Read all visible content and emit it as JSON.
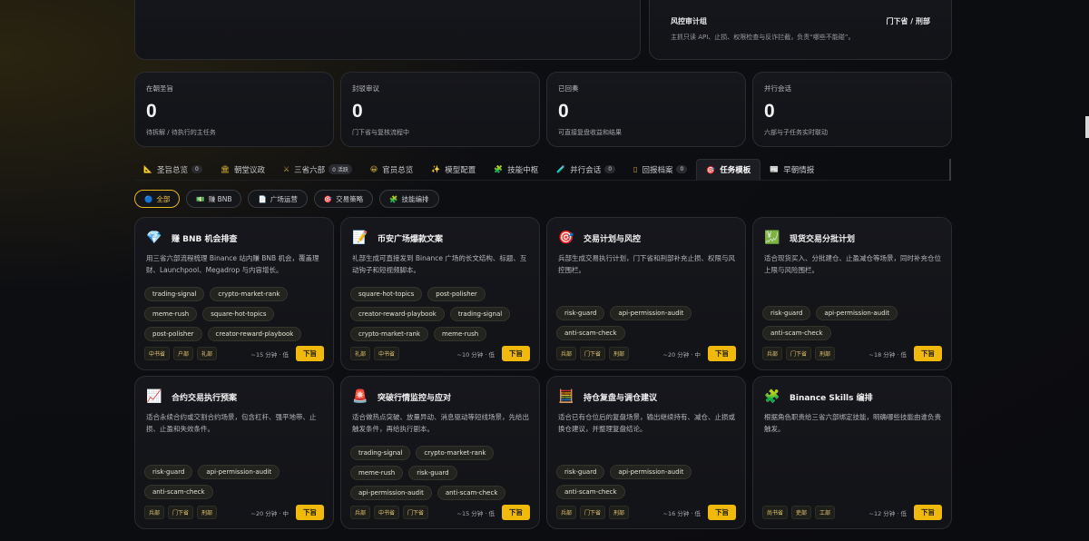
{
  "audit_group": {
    "title": "风控审计组",
    "depts": "门下省 / 刑部",
    "desc": "主抓只读 API、止损、权限检查与反诈拦截，负责“哪些不能碰”。"
  },
  "stats": [
    {
      "label": "在朝圣旨",
      "value": "0",
      "desc": "待拆解 / 待执行的主任务"
    },
    {
      "label": "封驳审议",
      "value": "0",
      "desc": "门下省与复核流程中"
    },
    {
      "label": "已回奏",
      "value": "0",
      "desc": "可直接复盘收益和结果"
    },
    {
      "label": "并行会话",
      "value": "0",
      "desc": "六部与子任务实时联动"
    }
  ],
  "tabs": [
    {
      "icon": "📐",
      "label": "圣旨总览",
      "badge": "0"
    },
    {
      "icon": "🏛",
      "label": "朝堂议政",
      "badge": ""
    },
    {
      "icon": "⚔",
      "label": "三省六部",
      "badge": "0 活跃"
    },
    {
      "icon": "😀",
      "label": "官员总览",
      "badge": ""
    },
    {
      "icon": "✨",
      "label": "模型配置",
      "badge": ""
    },
    {
      "icon": "🧩",
      "label": "技能中枢",
      "badge": ""
    },
    {
      "icon": "🧪",
      "label": "并行会话",
      "badge": "0"
    },
    {
      "icon": "▯",
      "label": "回报档案",
      "badge": "0"
    },
    {
      "icon": "🎯",
      "label": "任务模板",
      "badge": ""
    },
    {
      "icon": "📰",
      "label": "早朝情报",
      "badge": ""
    }
  ],
  "chips": [
    {
      "icon": "🔵",
      "label": "全部"
    },
    {
      "icon": "💵",
      "label": "赚 BNB"
    },
    {
      "icon": "📄",
      "label": "广场运营"
    },
    {
      "icon": "🎯",
      "label": "交易策略"
    },
    {
      "icon": "🧩",
      "label": "技能编排"
    }
  ],
  "cards": [
    {
      "icon": "💎",
      "title": "赚 BNB 机会排查",
      "desc": "用三省六部流程梳理 Binance 站内赚 BNB 机会，覆盖理财、Launchpool、Megadrop 与内容增长。",
      "skills": [
        "trading-signal",
        "crypto-market-rank",
        "meme-rush",
        "square-hot-topics",
        "post-polisher",
        "creator-reward-playbook"
      ],
      "depts": [
        "中书省",
        "户部",
        "礼部"
      ],
      "meta": "~15 分钟 · 低",
      "action": "下旨"
    },
    {
      "icon": "📝",
      "title": "币安广场爆款文案",
      "desc": "礼部生成可直接发到 Binance 广场的长文结构、标题、互动钩子和短视频脚本。",
      "skills": [
        "square-hot-topics",
        "post-polisher",
        "creator-reward-playbook",
        "trading-signal",
        "crypto-market-rank",
        "meme-rush"
      ],
      "depts": [
        "礼部",
        "中书省"
      ],
      "meta": "~10 分钟 · 低",
      "action": "下旨"
    },
    {
      "icon": "🎯",
      "title": "交易计划与风控",
      "desc": "兵部生成交易执行计划，门下省和刑部补充止损、权限与风控围栏。",
      "skills": [
        "risk-guard",
        "api-permission-audit",
        "anti-scam-check"
      ],
      "depts": [
        "兵部",
        "门下省",
        "刑部"
      ],
      "meta": "~20 分钟 · 中",
      "action": "下旨"
    },
    {
      "icon": "💹",
      "title": "现货交易分批计划",
      "desc": "适合现货买入、分批建仓、止盈减仓等场景，同时补充仓位上限与风险围栏。",
      "skills": [
        "risk-guard",
        "api-permission-audit",
        "anti-scam-check"
      ],
      "depts": [
        "兵部",
        "门下省",
        "刑部"
      ],
      "meta": "~18 分钟 · 低",
      "action": "下旨"
    },
    {
      "icon": "📈",
      "title": "合约交易执行预案",
      "desc": "适合永续合约或交割合约场景，包含杠杆、强平地带、止损、止盈和失效条件。",
      "skills": [
        "risk-guard",
        "api-permission-audit",
        "anti-scam-check"
      ],
      "depts": [
        "兵部",
        "门下省",
        "刑部"
      ],
      "meta": "~20 分钟 · 中",
      "action": "下旨"
    },
    {
      "icon": "🚨",
      "title": "突破行情监控与应对",
      "desc": "适合做热点突破、放量异动、消息驱动等短线场景，先给出触发条件，再给执行剧本。",
      "skills": [
        "trading-signal",
        "crypto-market-rank",
        "meme-rush",
        "risk-guard",
        "api-permission-audit",
        "anti-scam-check"
      ],
      "depts": [
        "兵部",
        "中书省",
        "门下省"
      ],
      "meta": "~15 分钟 · 低",
      "action": "下旨"
    },
    {
      "icon": "🧮",
      "title": "持仓复盘与调仓建议",
      "desc": "适合已有仓位后的复盘场景，输出继续持有、减仓、止损或换仓建议，并整理复盘结论。",
      "skills": [
        "risk-guard",
        "api-permission-audit",
        "anti-scam-check"
      ],
      "depts": [
        "兵部",
        "门下省",
        "刑部"
      ],
      "meta": "~16 分钟 · 低",
      "action": "下旨"
    },
    {
      "icon": "🧩",
      "title": "Binance Skills 编排",
      "desc": "根据角色职责给三省六部绑定技能，明确哪些技能由谁负责触发。",
      "skills": [],
      "depts": [
        "尚书省",
        "吏部",
        "工部"
      ],
      "meta": "~12 分钟 · 低",
      "action": "下旨"
    }
  ]
}
